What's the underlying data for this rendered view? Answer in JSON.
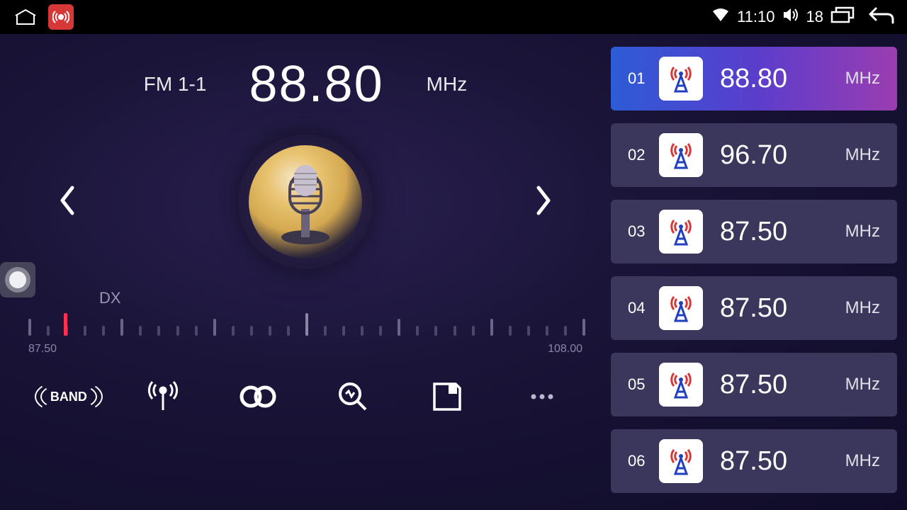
{
  "status": {
    "time": "11:10",
    "volume": "18"
  },
  "radio": {
    "band_label": "FM 1-1",
    "frequency": "88.80",
    "unit": "MHz",
    "dx_label": "DX",
    "scale_min": "87.50",
    "scale_max": "108.00"
  },
  "presets": [
    {
      "num": "01",
      "freq": "88.80",
      "unit": "MHz",
      "active": true
    },
    {
      "num": "02",
      "freq": "96.70",
      "unit": "MHz",
      "active": false
    },
    {
      "num": "03",
      "freq": "87.50",
      "unit": "MHz",
      "active": false
    },
    {
      "num": "04",
      "freq": "87.50",
      "unit": "MHz",
      "active": false
    },
    {
      "num": "05",
      "freq": "87.50",
      "unit": "MHz",
      "active": false
    },
    {
      "num": "06",
      "freq": "87.50",
      "unit": "MHz",
      "active": false
    }
  ],
  "toolbar": {
    "band": "BAND"
  }
}
